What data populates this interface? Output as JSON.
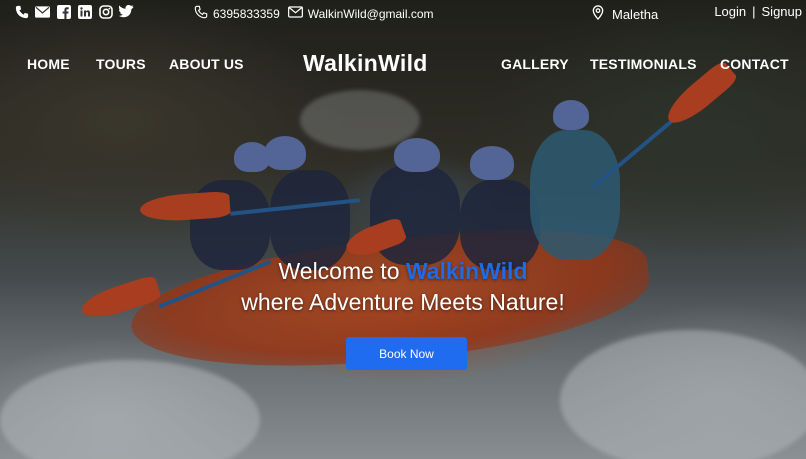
{
  "topbar": {
    "phone": "6395833359",
    "email": "WalkinWild@gmail.com",
    "location": "Maletha",
    "login_label": "Login",
    "separator": "|",
    "signup_label": "Signup",
    "socials": [
      "phone-icon",
      "envelope-icon",
      "facebook-icon",
      "linkedin-icon",
      "instagram-icon",
      "twitter-icon"
    ]
  },
  "nav": {
    "brand": "WalkinWild",
    "left_items": [
      "HOME",
      "TOURS",
      "ABOUT US"
    ],
    "right_items": [
      "GALLERY",
      "TESTIMONIALS",
      "CONTACT"
    ]
  },
  "hero": {
    "line1_prefix": "Welcome to ",
    "line1_accent": "WalkinWild",
    "line2": "where Adventure Meets Nature!",
    "button_label": "Book Now"
  },
  "colors": {
    "accent": "#1f6cf0",
    "text": "#ffffff"
  }
}
